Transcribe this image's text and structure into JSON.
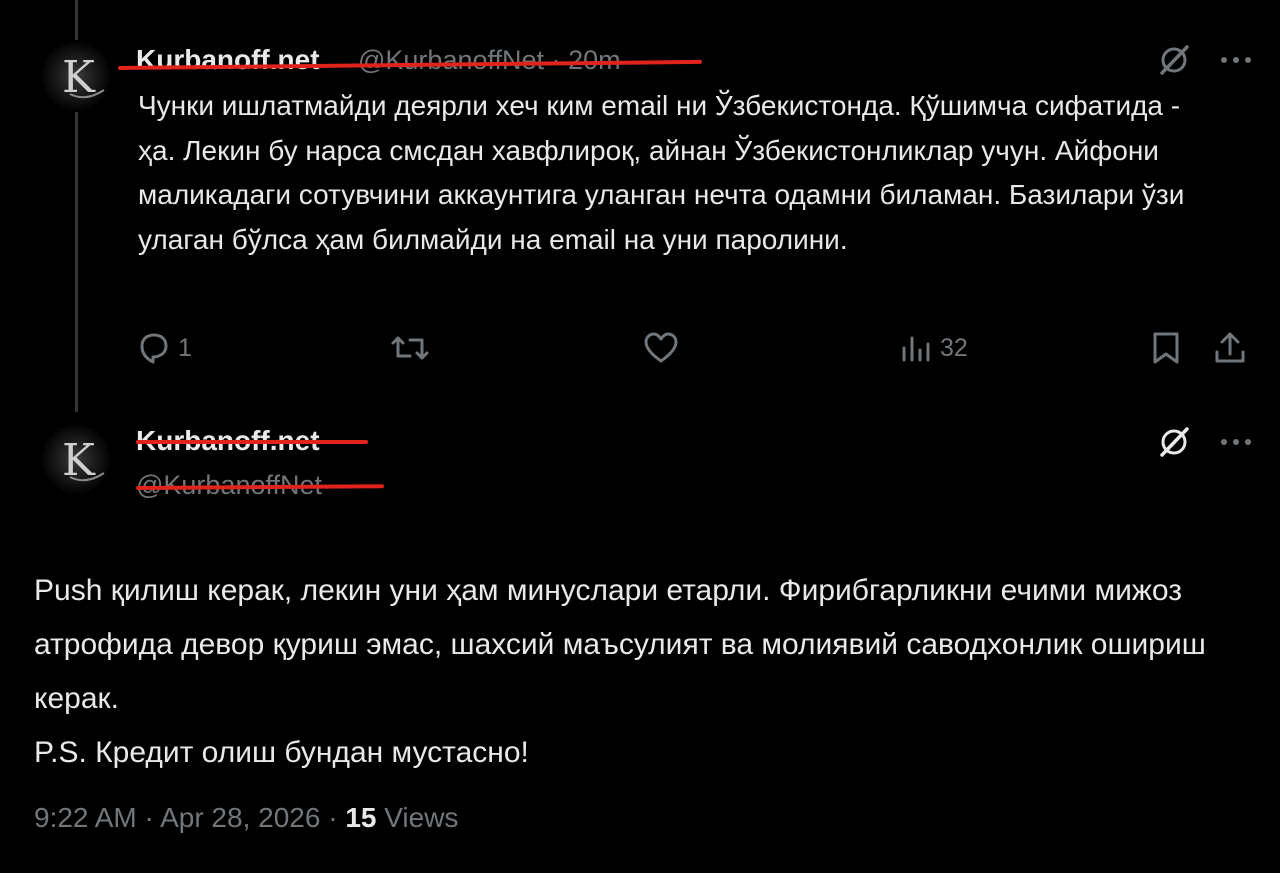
{
  "colors": {
    "background": "#000000",
    "text": "#e7e9ea",
    "muted": "#71767b",
    "strike": "#e0241b"
  },
  "parent_tweet": {
    "avatar_letter": "K",
    "author_name": "Kurbanoff.net",
    "author_handle": "@KurbanoffNet",
    "separator": "·",
    "time_ago": "20m",
    "text": "Чунки ишлатмайди деярли хеч ким email ни Ўзбекистонда. Қўшимча сифатида - ҳа. Лекин бу нарса смсдан хавфлироқ, айнан Ўзбекистонликлар учун. Айфони маликадаги сотувчини аккаунтига уланган нечта одамни биламан. Базилари ўзи улаган бўлса ҳам билмайди на email на уни паролини.",
    "actions": {
      "reply_count": "1",
      "repost_count": "",
      "like_count": "",
      "views_count": "32"
    },
    "icons": [
      "grok-icon",
      "more-icon",
      "reply-icon",
      "repost-icon",
      "like-icon",
      "views-icon",
      "bookmark-icon",
      "share-icon"
    ]
  },
  "reply_tweet": {
    "avatar_letter": "K",
    "author_name": "Kurbanoff.net",
    "author_handle": "@KurbanoffNet",
    "text_lines": [
      "Push қилиш керак, лекин уни ҳам минуслари етарли. Фирибгарликни ечими мижоз атрофида девор қуриш эмас, шахсий маъсулият ва молиявий саводхонлик ошириш керак.",
      "P.S. Кредит олиш бундан мустасно!"
    ],
    "time": "9:22 AM",
    "date": "Apr 28, 2026",
    "separator": "·",
    "views_count": "15",
    "views_label": "Views"
  }
}
